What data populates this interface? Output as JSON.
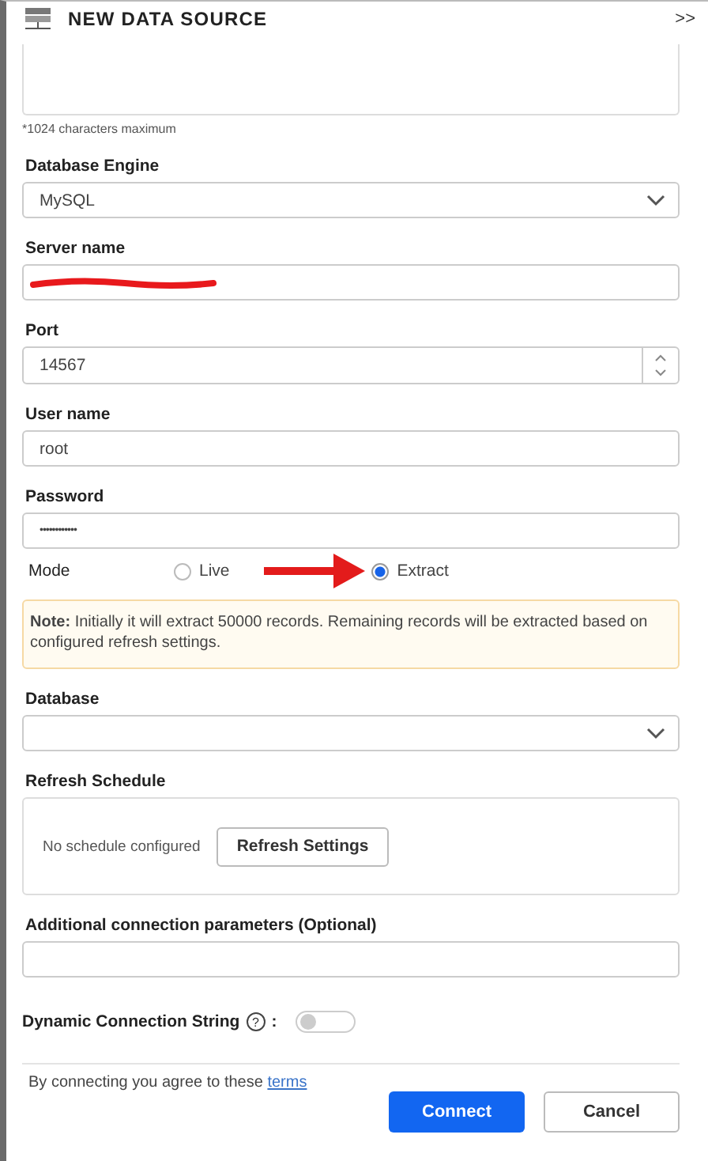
{
  "header": {
    "title": "NEW DATA SOURCE",
    "collapse": ">>"
  },
  "description": {
    "hint": "*1024 characters maximum"
  },
  "fields": [
    {
      "kind": "select",
      "label": "Database Engine",
      "value": "MySQL"
    },
    {
      "kind": "text",
      "label": "Server name",
      "redacted": true
    },
    {
      "kind": "number",
      "label": "Port",
      "value": "14567"
    },
    {
      "kind": "text",
      "label": "User name",
      "value": "root"
    },
    {
      "kind": "password",
      "label": "Password",
      "value": "••••••••••••"
    }
  ],
  "mode": {
    "label": "Mode",
    "options": [
      {
        "label": "Live",
        "selected": false
      },
      {
        "label": "Extract",
        "selected": true
      }
    ],
    "annotation_arrow": true
  },
  "note": "**Note:** Initially it will extract 50000 records. Remaining records will be extracted based on configured refresh settings.",
  "database": {
    "label": "Database"
  },
  "refresh_schedule": {
    "label": "Refresh Schedule",
    "status": "No schedule configured",
    "button": "Refresh Settings"
  },
  "additional_parameters": {
    "label": "Additional connection parameters (Optional)"
  },
  "dynamic_connection": {
    "label": "Dynamic Connection String",
    "help": "?",
    "colon": ":",
    "on": false
  },
  "footer": {
    "terms_text": "By connecting you agree to these",
    "terms_link": "terms"
  },
  "buttons": [
    {
      "label": "Connect",
      "kind": "primary"
    },
    {
      "label": "Cancel",
      "kind": "secondary"
    }
  ]
}
